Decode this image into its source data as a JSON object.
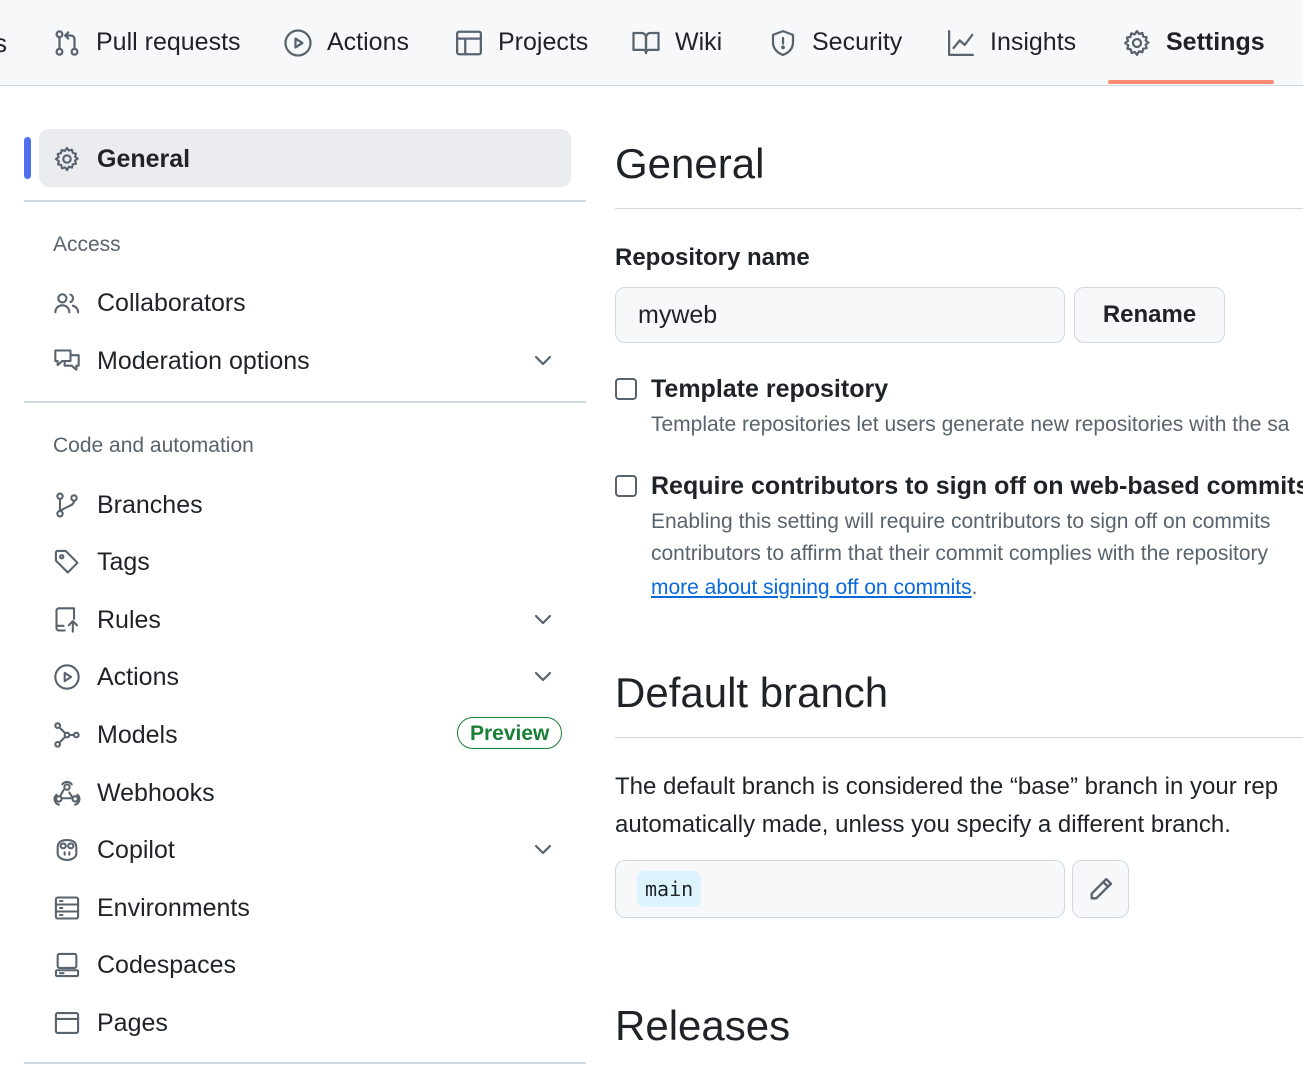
{
  "topnav": {
    "lead_fragment": "s",
    "tabs": [
      {
        "label": "Pull requests",
        "icon": "pull-request-icon"
      },
      {
        "label": "Actions",
        "icon": "play-circle-icon"
      },
      {
        "label": "Projects",
        "icon": "table-icon"
      },
      {
        "label": "Wiki",
        "icon": "book-icon"
      },
      {
        "label": "Security",
        "icon": "shield-icon"
      },
      {
        "label": "Insights",
        "icon": "graph-icon"
      },
      {
        "label": "Settings",
        "icon": "gear-icon",
        "active": true
      }
    ],
    "active_underline_color": "#fd8c73"
  },
  "sidebar": {
    "general": {
      "label": "General",
      "icon": "gear-icon",
      "active": true
    },
    "access": {
      "heading": "Access",
      "items": [
        {
          "label": "Collaborators",
          "icon": "people-icon"
        },
        {
          "label": "Moderation options",
          "icon": "comment-discussion-icon",
          "expandable": true
        }
      ]
    },
    "code_automation": {
      "heading": "Code and automation",
      "items": [
        {
          "label": "Branches",
          "icon": "git-branch-icon"
        },
        {
          "label": "Tags",
          "icon": "tag-icon"
        },
        {
          "label": "Rules",
          "icon": "repo-push-icon",
          "expandable": true
        },
        {
          "label": "Actions",
          "icon": "play-circle-icon",
          "expandable": true
        },
        {
          "label": "Models",
          "icon": "models-icon",
          "badge": "Preview"
        },
        {
          "label": "Webhooks",
          "icon": "webhook-icon"
        },
        {
          "label": "Copilot",
          "icon": "copilot-icon",
          "expandable": true
        },
        {
          "label": "Environments",
          "icon": "server-icon"
        },
        {
          "label": "Codespaces",
          "icon": "codespaces-icon"
        },
        {
          "label": "Pages",
          "icon": "browser-icon"
        }
      ]
    },
    "active_bar_color": "#4f6ff0",
    "badge_color": "#1a7f37"
  },
  "main": {
    "general_title": "General",
    "repo_name_label": "Repository name",
    "repo_name_value": "myweb",
    "rename_button": "Rename",
    "template_repo": {
      "title": "Template repository",
      "checked": false,
      "description": "Template repositories let users generate new repositories with the sa"
    },
    "signoff": {
      "title": "Require contributors to sign off on web-based commits",
      "checked": false,
      "description_line1": "Enabling this setting will require contributors to sign off on commits",
      "description_line2": "contributors to affirm that their commit complies with the repository",
      "link_text": "more about signing off on commits",
      "link_suffix": "."
    },
    "default_branch": {
      "title": "Default branch",
      "text_line1": "The default branch is considered the “base” branch in your rep",
      "text_line2": "automatically made, unless you specify a different branch.",
      "branch_name": "main",
      "edit_icon": "pencil-icon"
    },
    "releases_title": "Releases",
    "link_color": "#0969da"
  }
}
